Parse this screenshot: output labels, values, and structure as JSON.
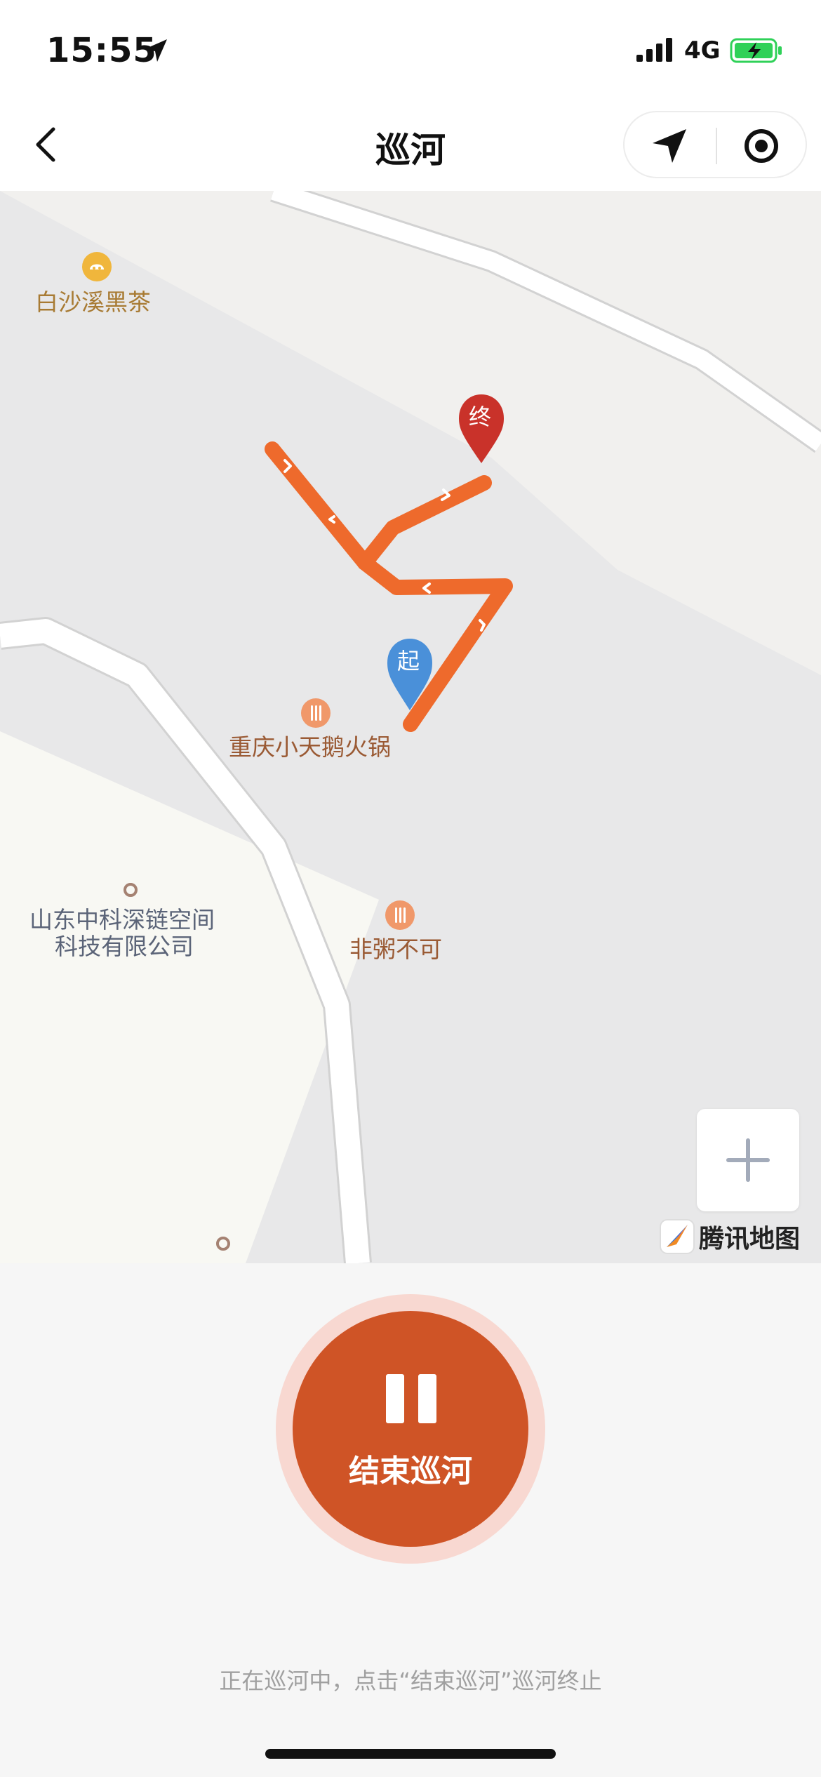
{
  "status_bar": {
    "time": "15:55",
    "network": "4G",
    "icons": [
      "location-arrow-icon",
      "signal-icon",
      "battery-charging-icon"
    ],
    "battery_color": "#2fd158"
  },
  "nav": {
    "title": "巡河",
    "icons": [
      "back-chevron-icon",
      "navigation-arrow-icon",
      "target-icon"
    ]
  },
  "map": {
    "pois": {
      "tea": "白沙溪黑茶",
      "hotpot": "重庆小天鹅火锅",
      "company_line1": "山东中科深链空间",
      "company_line2": "科技有限公司",
      "porridge": "非粥不可"
    },
    "markers": {
      "start": "起",
      "end": "终"
    },
    "route_color": "#ee6a2c",
    "start_color": "#4a90d9",
    "end_color": "#c9322a",
    "zoom_symbol": "+",
    "provider": "腾讯地图"
  },
  "controls": {
    "end_button_label": "结束巡河",
    "end_button_color": "#cf5426",
    "hint": "正在巡河中，点击“结束巡河”巡河终止"
  }
}
